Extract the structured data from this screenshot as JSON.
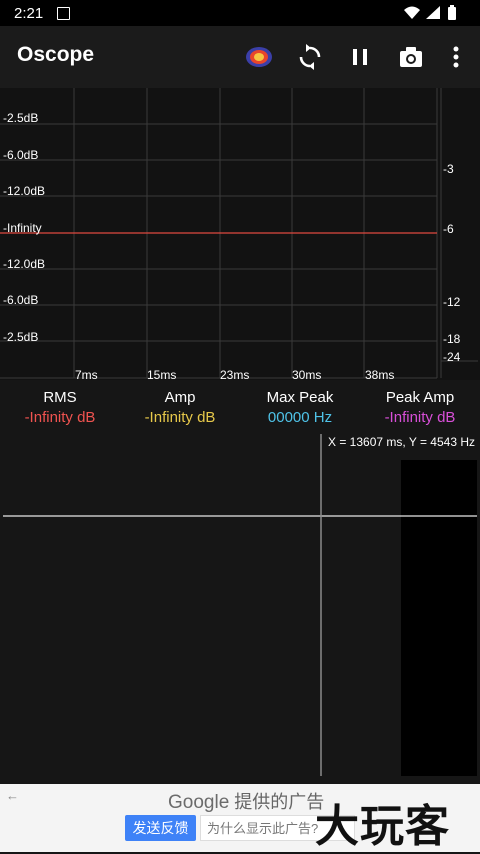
{
  "status_bar": {
    "time": "2:21"
  },
  "toolbar": {
    "title": "Oscope",
    "icons": [
      "spectrum-color-icon",
      "refresh-icon",
      "pause-icon",
      "camera-icon",
      "more-vert-icon"
    ]
  },
  "scope": {
    "left_labels": [
      "-2.5dB",
      "-6.0dB",
      "-12.0dB",
      "-Infinity",
      "-12.0dB",
      "-6.0dB",
      "-2.5dB"
    ],
    "right_labels": [
      "-3",
      "-6",
      "-12",
      "-18",
      "-24"
    ],
    "time_labels": [
      "7ms",
      "15ms",
      "23ms",
      "30ms",
      "38ms"
    ],
    "signal_color": "#e0483f"
  },
  "stats": [
    {
      "title": "RMS",
      "value": "-Infinity dB",
      "color": "#ef5350"
    },
    {
      "title": "Amp",
      "value": "-Infinity dB",
      "color": "#e6c84a"
    },
    {
      "title": "Max Peak",
      "value": "00000 Hz",
      "color": "#4fc3e8"
    },
    {
      "title": "Peak Amp",
      "value": "-Infinity dB",
      "color": "#d84fd8"
    }
  ],
  "spectrogram": {
    "readout": "X = 13607 ms, Y = 4543 Hz"
  },
  "ad": {
    "back_symbol": "←",
    "google": "Google",
    "provided": "提供的广告",
    "feedback_button": "发送反馈",
    "why_button": "为什么显示此广告?"
  },
  "watermark": "大玩客"
}
